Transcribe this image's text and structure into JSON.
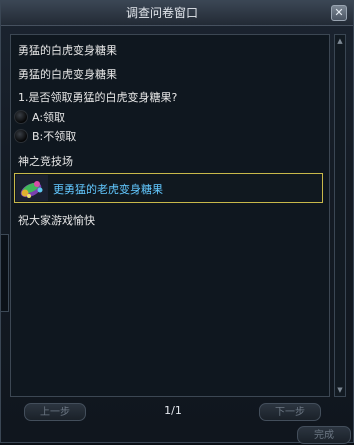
{
  "window": {
    "title": "调查问卷窗口",
    "close_glyph": "✕"
  },
  "content": {
    "header_line_1": "勇猛的白虎变身糖果",
    "header_line_2": "勇猛的白虎变身糖果",
    "question": "1.是否领取勇猛的白虎变身糖果?",
    "options": [
      {
        "label": "A:领取",
        "selected": false
      },
      {
        "label": "B:不领取",
        "selected": false
      }
    ],
    "section_label": "神之竞技场",
    "reward": {
      "label": "更勇猛的老虎变身糖果",
      "icon": "candy-item-icon"
    },
    "closing": "祝大家游戏愉快"
  },
  "scrollbar": {
    "up_glyph": "▲",
    "down_glyph": "▼"
  },
  "footer": {
    "prev_label": "上一步",
    "page_indicator": "1/1",
    "next_label": "下一步",
    "complete_label": "完成"
  },
  "colors": {
    "text": "#e6e6e6",
    "reward_text": "#62c8ff",
    "reward_border": "#c8b84a",
    "disabled_text": "#6c7784"
  }
}
